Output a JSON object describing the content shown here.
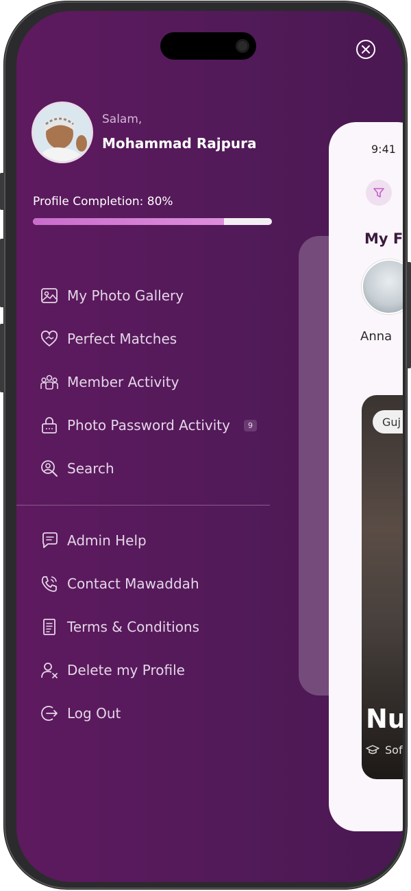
{
  "header": {
    "greeting": "Salam,",
    "user_name": "Mohammad Rajpura"
  },
  "profile_completion": {
    "label": "Profile Completion: 80%",
    "value": 0.8
  },
  "menu": {
    "primary": [
      {
        "id": "photo-gallery",
        "label": "My Photo Gallery",
        "icon": "image-icon"
      },
      {
        "id": "perfect-matches",
        "label": "Perfect Matches",
        "icon": "heart-handshake-icon"
      },
      {
        "id": "member-activity",
        "label": "Member Activity",
        "icon": "users-icon"
      },
      {
        "id": "photo-password-activity",
        "label": "Photo Password Activity",
        "icon": "lock-icon",
        "badge": "9"
      },
      {
        "id": "search",
        "label": "Search",
        "icon": "user-search-icon"
      }
    ],
    "secondary": [
      {
        "id": "admin-help",
        "label": "Admin Help",
        "icon": "chat-icon"
      },
      {
        "id": "contact",
        "label": "Contact Mawaddah",
        "icon": "phone-icon"
      },
      {
        "id": "terms",
        "label": "Terms & Conditions",
        "icon": "document-icon"
      },
      {
        "id": "delete-profile",
        "label": "Delete my Profile",
        "icon": "user-delete-icon"
      },
      {
        "id": "logout",
        "label": "Log Out",
        "icon": "logout-icon"
      }
    ]
  },
  "preview": {
    "time": "9:41",
    "section_title": "My Fa",
    "favorite_name": "Anna",
    "tag": "Guj",
    "card_name": "Nu",
    "card_sub": "Sof"
  },
  "colors": {
    "background": "#521a59",
    "accent": "#d07ed2",
    "text_muted": "#e5d6e8"
  }
}
